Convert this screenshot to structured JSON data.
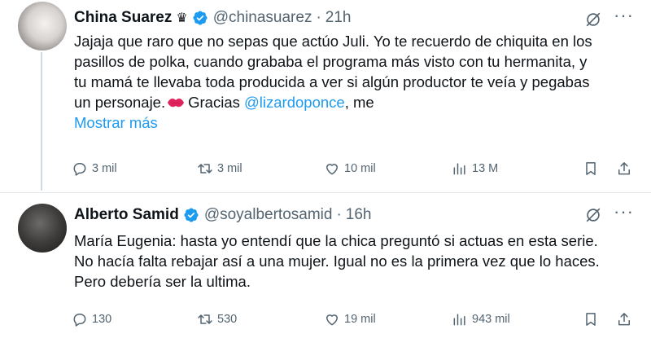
{
  "tweets": [
    {
      "author_name": "China Suarez",
      "author_badge_glyph": "♛",
      "handle": "@chinasuarez",
      "separator": "·",
      "time": "21h",
      "text_lines": [
        "Jajaja que raro que no sepas que actúo Juli. Yo te recuerdo de chiquita en los",
        "pasillos de polka, cuando grababa el programa más visto con tu hermanita, y",
        "tu mamá te llevaba toda producida a ver si algún productor te veía y pegabas"
      ],
      "last_line_before_emoji": "un personaje.",
      "emoji": "kiss-lips-icon",
      "last_line_after_emoji": "Gracias",
      "mention": "@lizardoponce",
      "last_line_tail": ", me",
      "show_more": "Mostrar más",
      "stats": {
        "replies": "3 mil",
        "retweets": "3 mil",
        "likes": "10 mil",
        "views": "13 M"
      }
    },
    {
      "author_name": "Alberto Samid",
      "handle": "@soyalbertosamid",
      "separator": "·",
      "time": "16h",
      "text_lines": [
        "María Eugenia: hasta yo entendí que la chica preguntó si actuas en esta serie.",
        "No hacía falta rebajar así a una mujer. Igual no es la primera vez que lo haces.",
        "Pero debería ser la ultima."
      ],
      "stats": {
        "replies": "130",
        "retweets": "530",
        "likes": "19 mil",
        "views": "943 mil"
      }
    }
  ],
  "more_menu_glyph": "···",
  "colors": {
    "accent": "#1d9bf0",
    "secondary_text": "#536471",
    "verified": "#1d9bf0"
  }
}
